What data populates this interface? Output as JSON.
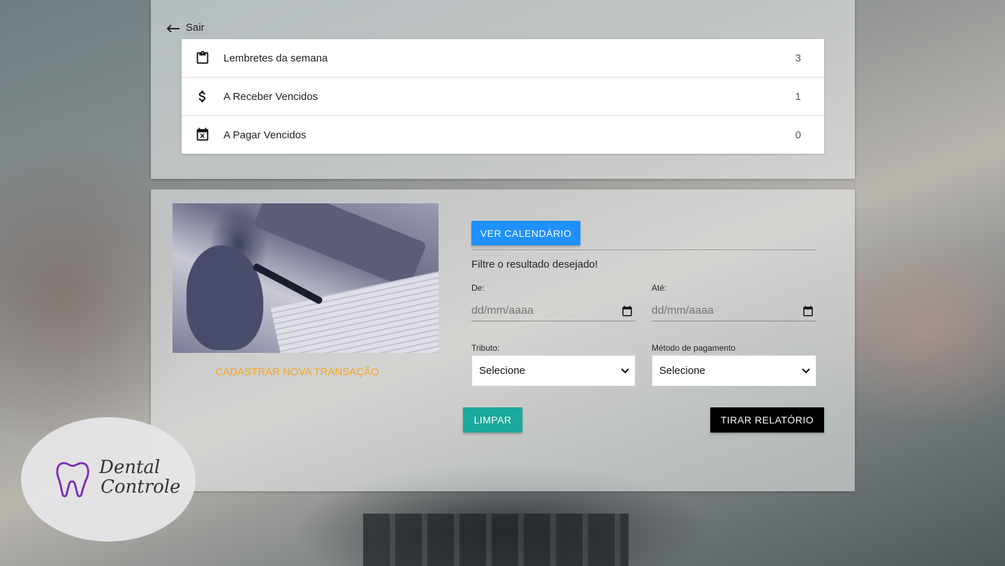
{
  "header": {
    "logout_label": "Sair"
  },
  "summary": {
    "items": [
      {
        "icon": "clipboard-icon",
        "label": "Lembretes da semana",
        "count": "3"
      },
      {
        "icon": "dollar-icon",
        "label": "A Receber Vencidos",
        "count": "1"
      },
      {
        "icon": "calendar-x-icon",
        "label": "A Pagar Vencidos",
        "count": "0"
      }
    ]
  },
  "transactions": {
    "new_transaction_label": "CADASTRAR NOVA TRANSAÇÃO",
    "calendar_button": "VER CALENDÁRIO",
    "filter_heading": "Filtre o resultado desejado!",
    "from_label": "De:",
    "from_placeholder": "dd/mm/aaaa",
    "to_label": "Até:",
    "to_placeholder": "dd/mm/aaaa",
    "tax_label": "Tributo:",
    "tax_selected": "Selecione",
    "payment_label": "Método de pagamento",
    "payment_selected": "Selecione",
    "clear_button": "LIMPAR",
    "report_button": "TIRAR RELATÓRIO"
  },
  "logo": {
    "line1": "Dental",
    "line2": "Controle"
  },
  "colors": {
    "primary_button": "#1e90ff",
    "clear_button": "#1aa99a",
    "report_button": "#000000",
    "link_accent": "#f5a623",
    "logo_tooth": "#7b2fb5"
  }
}
